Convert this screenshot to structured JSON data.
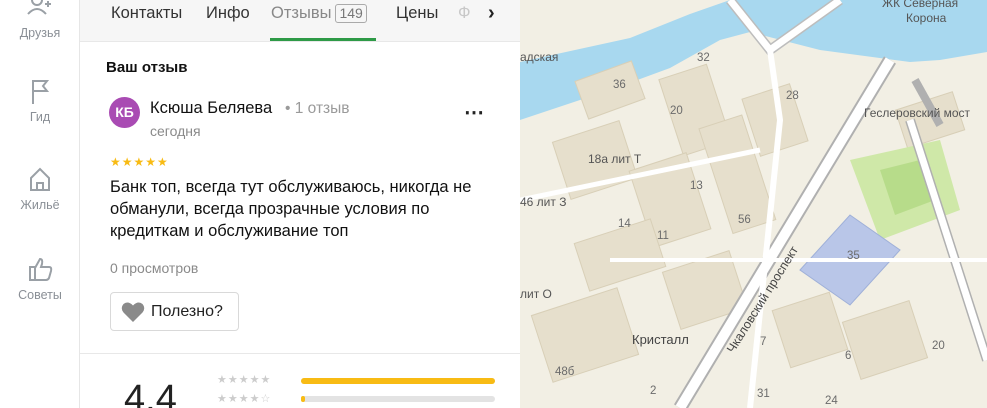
{
  "rail": {
    "items": [
      {
        "label": "Друзья",
        "icon": "friends-icon"
      },
      {
        "label": "Гид",
        "icon": "flag-icon"
      },
      {
        "label": "Жильё",
        "icon": "house-icon"
      },
      {
        "label": "Советы",
        "icon": "thumbs-up-icon"
      }
    ]
  },
  "tabs": {
    "contacts": "Контакты",
    "info": "Инфо",
    "reviews": "Отзывы",
    "reviews_count": "149",
    "prices": "Цены",
    "more_partial": "Ф"
  },
  "review_section": {
    "title": "Ваш отзыв",
    "avatar_initials": "КБ",
    "avatar_color": "#a94bb3",
    "author": "Ксюша Беляева",
    "author_meta": "• 1 отзыв",
    "date": "сегодня",
    "stars": "★★★★★",
    "rating_value": 5,
    "text": "Банк топ, всегда тут обслуживаюсь, никогда не обманули, всегда прозрачные условия по кредиткам и обслуживание топ",
    "views": "0 просмотров",
    "useful_label": "Полезно?",
    "menu": "⋯"
  },
  "summary": {
    "rating": "4.4",
    "bars": [
      {
        "stars": "★★★★★",
        "fill_percent": 100
      },
      {
        "stars": "★★★★☆",
        "fill_percent": 2
      }
    ]
  },
  "map": {
    "labels": {
      "zhk": "ЖК Северная",
      "zhk2": "Корона",
      "bridge": "Геслеровский мост",
      "prospect": "Чкаловский проспект",
      "kristall": "Кристалл",
      "street_partial": "адская",
      "lit_t": "18а лит Т",
      "lit_z": "46 лит З",
      "lit_o": "лит О"
    },
    "numbers": [
      "36",
      "32",
      "28",
      "20",
      "13",
      "14",
      "11",
      "56",
      "35",
      "7",
      "6",
      "20",
      "48б",
      "31",
      "2",
      "24"
    ],
    "colors": {
      "water": "#a8d8ef",
      "road": "#ffffff",
      "park": "#cfe8a8",
      "building": "#e8e1d0"
    }
  }
}
